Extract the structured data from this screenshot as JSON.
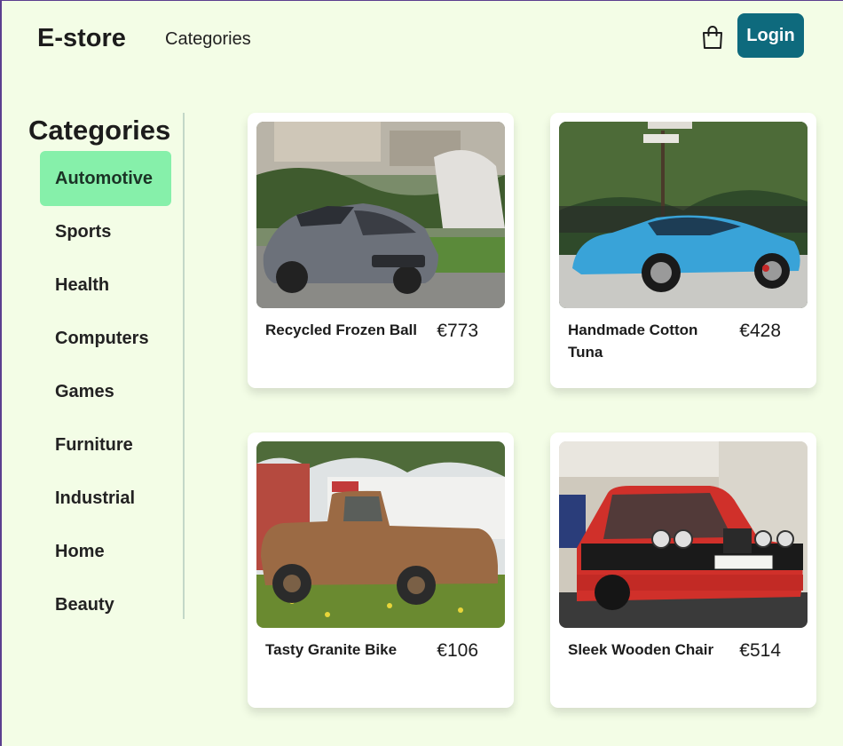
{
  "header": {
    "brand": "E-store",
    "nav_categories": "Categories",
    "login_label": "Login",
    "cart_icon": "shopping-bag-icon"
  },
  "sidebar": {
    "title": "Categories",
    "items": [
      {
        "label": "Automotive",
        "active": true
      },
      {
        "label": "Sports"
      },
      {
        "label": "Health"
      },
      {
        "label": "Computers"
      },
      {
        "label": "Games"
      },
      {
        "label": "Furniture"
      },
      {
        "label": "Industrial"
      },
      {
        "label": "Home"
      },
      {
        "label": "Beauty"
      }
    ]
  },
  "products": [
    {
      "name": "Recycled Frozen Ball",
      "price": "€773",
      "image": "grey-sports-car"
    },
    {
      "name": "Handmade Cotton Tuna",
      "price": "€428",
      "image": "blue-sports-car"
    },
    {
      "name": "Tasty Granite Bike",
      "price": "€106",
      "image": "rusty-pickup-truck"
    },
    {
      "name": "Sleek Wooden Chair",
      "price": "€514",
      "image": "red-classic-sedan"
    }
  ],
  "colors": {
    "background": "#f3fde6",
    "login_button": "#0e6a7d",
    "active_category": "#86f0aa"
  }
}
